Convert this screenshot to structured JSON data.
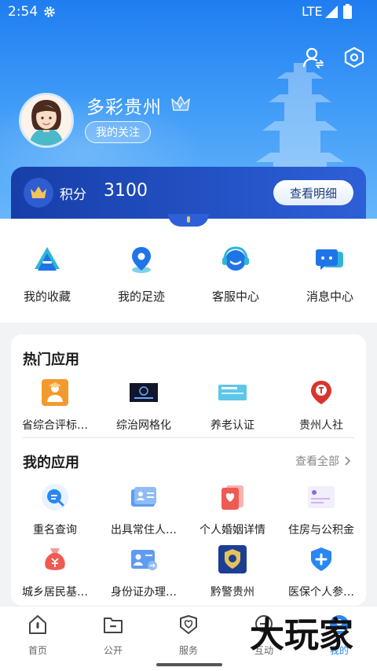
{
  "status_bar": {
    "time": "2:54",
    "network": "LTE"
  },
  "profile": {
    "username": "多彩贵州",
    "follow_label": "我的关注"
  },
  "points": {
    "label": "积分",
    "value": "3100",
    "detail_label": "查看明细"
  },
  "quick_actions": [
    {
      "label": "我的收藏",
      "icon": "bookmark-icon"
    },
    {
      "label": "我的足迹",
      "icon": "location-pin-icon"
    },
    {
      "label": "客服中心",
      "icon": "headset-icon"
    },
    {
      "label": "消息中心",
      "icon": "message-icon"
    }
  ],
  "hot_apps": {
    "title": "热门应用",
    "items": [
      {
        "label": "省综合评标…",
        "icon": "evaluation-icon"
      },
      {
        "label": "综治网格化",
        "icon": "grid-governance-icon"
      },
      {
        "label": "养老认证",
        "icon": "pension-auth-icon"
      },
      {
        "label": "贵州人社",
        "icon": "hr-social-icon"
      }
    ]
  },
  "my_apps": {
    "title": "我的应用",
    "view_all": "查看全部",
    "items": [
      {
        "label": "重名查询",
        "icon": "name-search-icon"
      },
      {
        "label": "出具常住人…",
        "icon": "id-card-icon"
      },
      {
        "label": "个人婚姻详情",
        "icon": "marriage-icon"
      },
      {
        "label": "住房与公积金",
        "icon": "housing-fund-icon"
      },
      {
        "label": "城乡居民基…",
        "icon": "money-bag-icon"
      },
      {
        "label": "身份证办理…",
        "icon": "id-process-icon"
      },
      {
        "label": "黔警贵州",
        "icon": "police-badge-icon"
      },
      {
        "label": "医保个人参…",
        "icon": "medical-shield-icon"
      }
    ]
  },
  "tabs": [
    {
      "label": "首页",
      "icon": "home-icon"
    },
    {
      "label": "公开",
      "icon": "folder-icon"
    },
    {
      "label": "服务",
      "icon": "heart-service-icon"
    },
    {
      "label": "互动",
      "icon": "chat-icon"
    },
    {
      "label": "我的",
      "icon": "user-icon"
    }
  ],
  "watermark": {
    "text": "大玩家"
  },
  "colors": {
    "primary": "#1f7df0",
    "card_dark": "#173ea8",
    "accent_orange": "#f39a2d"
  }
}
